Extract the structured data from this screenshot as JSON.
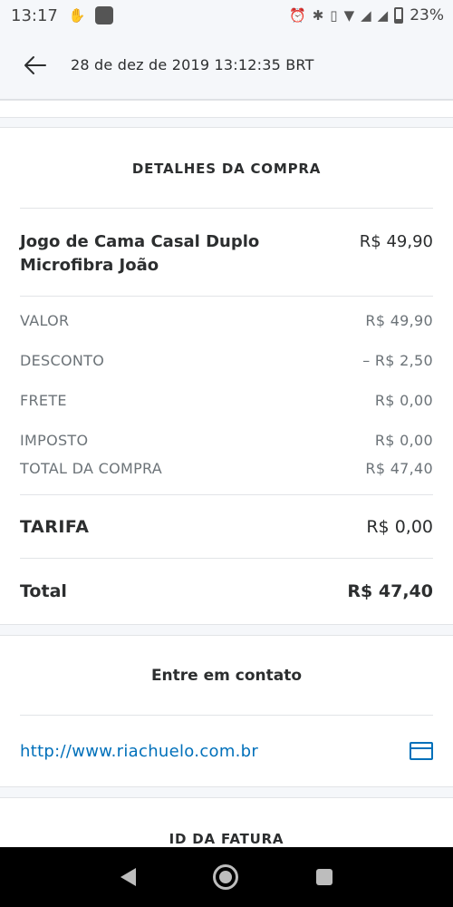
{
  "status_bar": {
    "time": "13:17",
    "battery_percent": "23%",
    "icons": [
      "hand-icon",
      "app-icon",
      "alarm-icon",
      "bluetooth-icon",
      "vibrate-icon",
      "wifi-icon",
      "signal-icon",
      "signal-icon",
      "battery-icon"
    ]
  },
  "header": {
    "title": "28 de dez de 2019 13:12:35 BRT",
    "back_icon": "arrow-left-icon"
  },
  "details": {
    "section_title": "DETALHES DA COMPRA",
    "product": {
      "name": "Jogo de Cama Casal Duplo Microfibra João",
      "price": "R$ 49,90"
    },
    "rows": [
      {
        "label": "VALOR",
        "value": "R$ 49,90"
      },
      {
        "label": "DESCONTO",
        "value": "– R$ 2,50"
      },
      {
        "label": "FRETE",
        "value": "R$ 0,00"
      },
      {
        "label": "IMPOSTO",
        "value": "R$ 0,00"
      },
      {
        "label": "TOTAL DA COMPRA",
        "value": "R$ 47,40"
      }
    ],
    "tarifa": {
      "label": "TARIFA",
      "value": "R$ 0,00"
    },
    "total": {
      "label": "Total",
      "value": "R$ 47,40"
    }
  },
  "contact": {
    "title": "Entre em contato",
    "link": "http://www.riachuelo.com.br",
    "link_icon": "browser-icon"
  },
  "invoice": {
    "title": "ID DA FATURA"
  },
  "colors": {
    "link": "#0070ba",
    "text": "#2c2e2f",
    "muted": "#6c7378",
    "background": "#f5f7fa"
  }
}
